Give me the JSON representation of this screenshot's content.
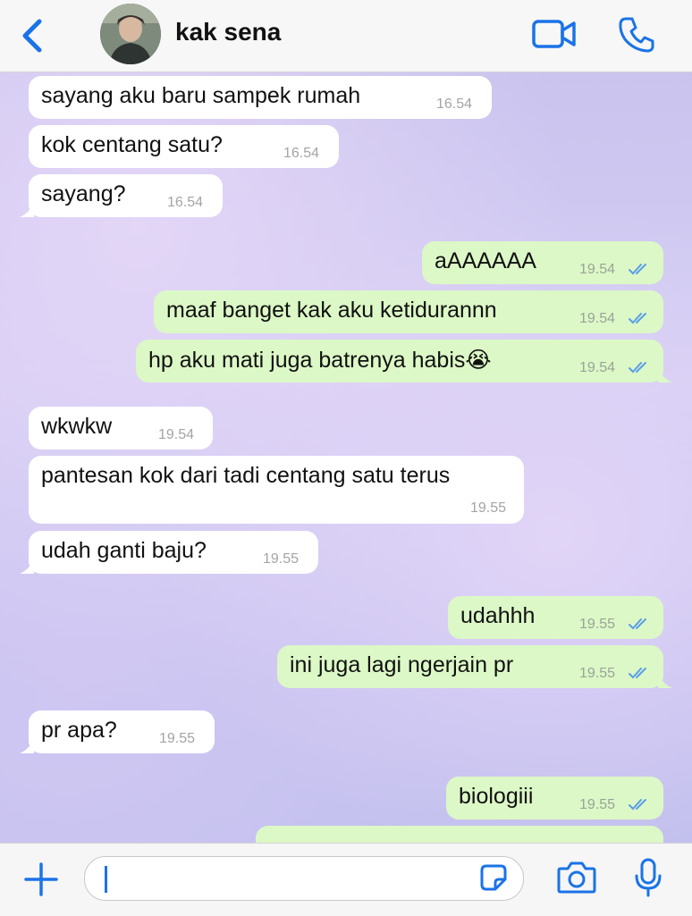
{
  "header": {
    "contact_name": "kak sena"
  },
  "messages": [
    {
      "dir": "in",
      "text": "sayang aku baru sampek rumah",
      "time": "16.54"
    },
    {
      "dir": "in",
      "text": "kok centang satu?",
      "time": "16.54"
    },
    {
      "dir": "in",
      "text": "sayang?",
      "time": "16.54"
    },
    {
      "dir": "out",
      "text": "aAAAAAA",
      "time": "19.54"
    },
    {
      "dir": "out",
      "text": "maaf banget kak aku ketidurannn",
      "time": "19.54"
    },
    {
      "dir": "out",
      "text": "hp aku mati juga batrenya habis😭",
      "time": "19.54"
    },
    {
      "dir": "in",
      "text": "wkwkw",
      "time": "19.54"
    },
    {
      "dir": "in",
      "text": "pantesan kok dari tadi centang satu terus",
      "time": "19.55"
    },
    {
      "dir": "in",
      "text": "udah ganti baju?",
      "time": "19.55"
    },
    {
      "dir": "out",
      "text": "udahhh",
      "time": "19.55"
    },
    {
      "dir": "out",
      "text": "ini juga lagi ngerjain pr",
      "time": "19.55"
    },
    {
      "dir": "in",
      "text": "pr apa?",
      "time": "19.55"
    },
    {
      "dir": "out",
      "text": "biologiii",
      "time": "19.55"
    }
  ],
  "icons": {
    "back": "chevron-left-icon",
    "video": "video-camera-icon",
    "phone": "phone-icon",
    "plus": "plus-icon",
    "sticker": "sticker-icon",
    "camera": "camera-icon",
    "mic": "microphone-icon"
  },
  "colors": {
    "accent": "#1a73e8",
    "incoming_bubble": "#ffffff",
    "outgoing_bubble": "#dcf8c6",
    "read_ticks": "#5b9ee8"
  }
}
